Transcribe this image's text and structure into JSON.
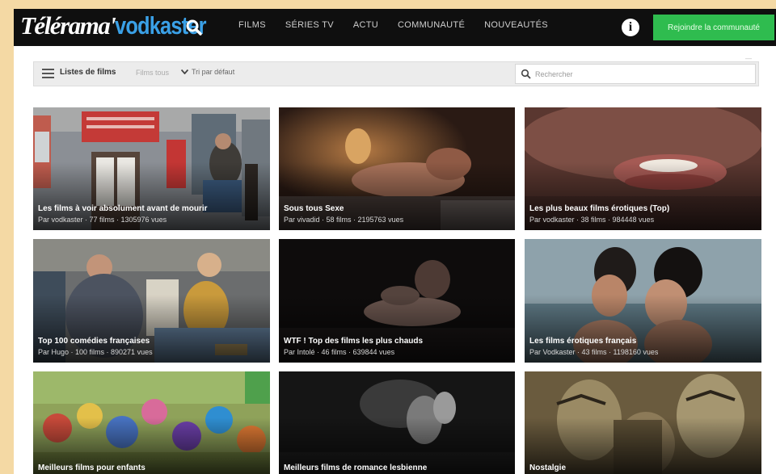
{
  "header": {
    "logo_part1": "Télérama'",
    "logo_part2": "vodkaster",
    "nav": [
      "Films",
      "Séries TV",
      "Actu",
      "Communauté",
      "Nouveautés"
    ],
    "cta_label": "Rejoindre la communauté",
    "colors": {
      "bar": "#0f0f0f",
      "logo_accent": "#3aa0e6",
      "cta": "#2fbc4f"
    }
  },
  "toolbar": {
    "title": "Listes de films",
    "filter_label": "Films tous",
    "sort_label": "Tri par défaut",
    "search_placeholder": "Rechercher"
  },
  "cards": [
    {
      "title": "Les films à voir absolument avant de mourir",
      "meta": "Par vodkaster · 77 films · 1305976 vues"
    },
    {
      "title": "Sous tous Sexe",
      "meta": "Par vivadid · 58 films · 2195763 vues"
    },
    {
      "title": "Les plus beaux films érotiques (Top)",
      "meta": "Par vodkaster · 38 films · 984448 vues"
    },
    {
      "title": "Top 100 comédies françaises",
      "meta": "Par Hugo · 100 films · 890271 vues"
    },
    {
      "title": "WTF ! Top des films les plus chauds",
      "meta": "Par Intolé · 46 films · 639844 vues"
    },
    {
      "title": "Les films érotiques français",
      "meta": "Par Vodkaster · 43 films · 1198160 vues"
    },
    {
      "title": "Meilleurs films pour enfants",
      "meta": ""
    },
    {
      "title": "Meilleurs films de romance lesbienne",
      "meta": ""
    },
    {
      "title": "Nostalgie",
      "meta": ""
    }
  ]
}
